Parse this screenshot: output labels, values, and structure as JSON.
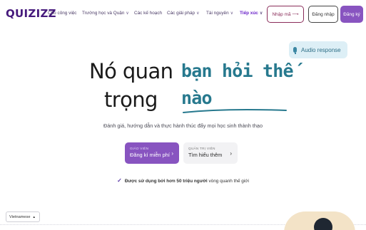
{
  "header": {
    "logo": "QUIZIZZ",
    "nav": [
      {
        "label": "Cho công việc",
        "has_caret": false
      },
      {
        "label": "Trường học và Quận",
        "has_caret": true
      },
      {
        "label": "Các kế hoạch",
        "has_caret": false
      },
      {
        "label": "Các giải pháp",
        "has_caret": true
      },
      {
        "label": "Tài nguyên",
        "has_caret": true
      },
      {
        "label": "Tiếp xúc",
        "has_caret": true
      }
    ],
    "enter_code_label": "Nhập mã ⟶",
    "login_label": "Đăng nhập",
    "signup_label": "Đăng ký"
  },
  "hero": {
    "audio_badge": "Audio response",
    "headline_left_1": "Nó quan",
    "headline_left_2": "trọng",
    "headline_right_1": "bạn hỏi thế",
    "headline_right_2": "nào",
    "subtitle": "Đánh giá, hướng dẫn và thực hành thúc đẩy mọi học sinh thành thạo",
    "teacher_cta": {
      "overline": "GIÁO VIÊN",
      "label": "Đăng kí miễn phí"
    },
    "admin_cta": {
      "overline": "QUẢN TRỊ VIÊN",
      "label": "Tìm hiểu thêm"
    },
    "trust_prefix": "Được sử dụng bởi hơn 50 triệu người",
    "trust_suffix": " vòng quanh thế giới"
  },
  "footer": {
    "language": "Vietnamese"
  },
  "colors": {
    "brand": "#461a7c",
    "primary": "#8854c0",
    "accent_teal": "#27798e",
    "enter_code": "#8a2d5a"
  }
}
